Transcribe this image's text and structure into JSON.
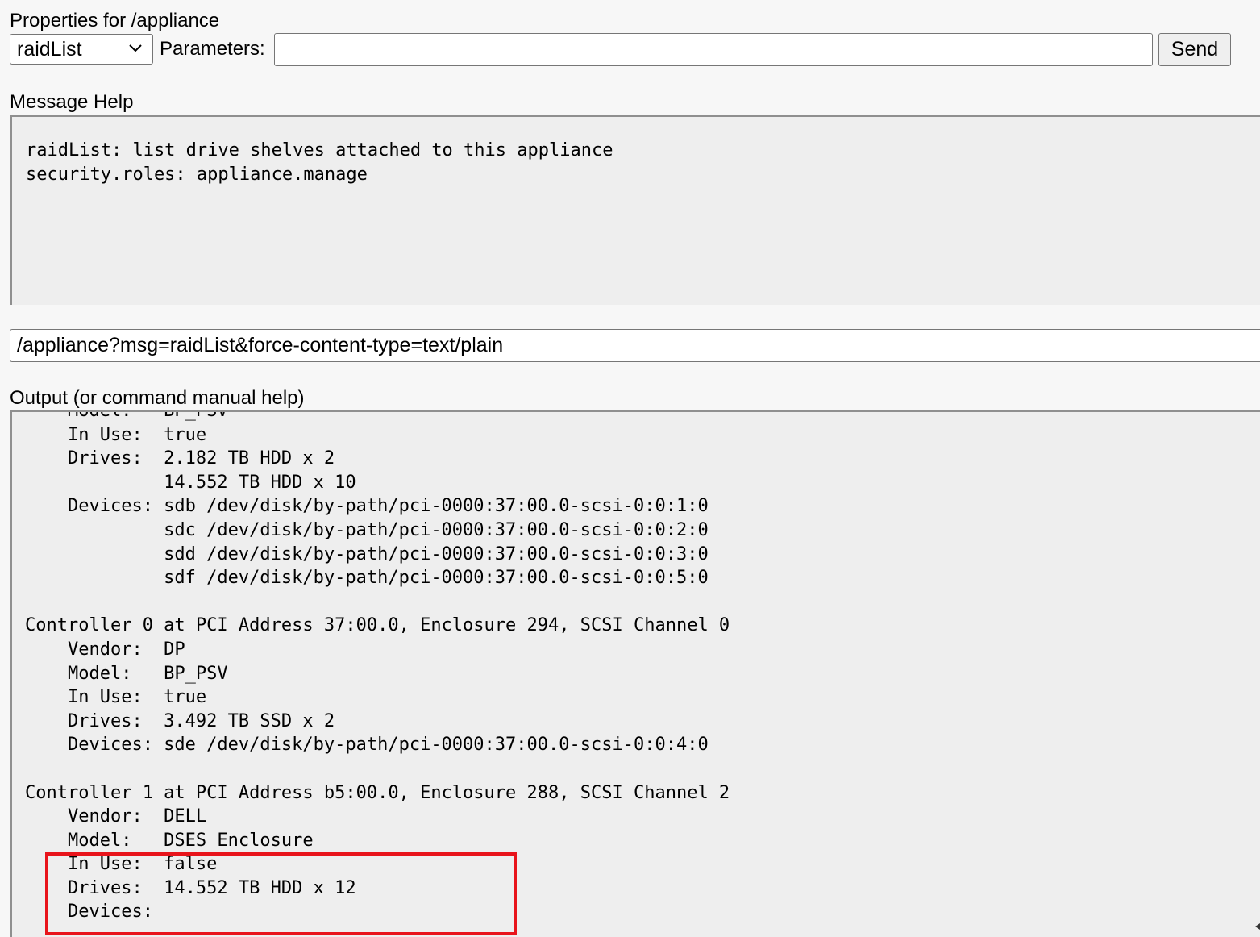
{
  "header": {
    "title": "Properties for /appliance",
    "message_select": {
      "value": "raidList",
      "icon": "chevron-down-icon"
    },
    "parameters_label": "Parameters:",
    "parameters_value": "",
    "send_label": "Send"
  },
  "help": {
    "label": "Message Help",
    "text": "raidList: list drive shelves attached to this appliance\nsecurity.roles: appliance.manage"
  },
  "request": {
    "url": "/appliance?msg=raidList&force-content-type=text/plain"
  },
  "output": {
    "label": "Output (or command manual help)",
    "text": "    Model:   BP_PSV\n    In Use:  true\n    Drives:  2.182 TB HDD x 2\n             14.552 TB HDD x 10\n    Devices: sdb /dev/disk/by-path/pci-0000:37:00.0-scsi-0:0:1:0\n             sdc /dev/disk/by-path/pci-0000:37:00.0-scsi-0:0:2:0\n             sdd /dev/disk/by-path/pci-0000:37:00.0-scsi-0:0:3:0\n             sdf /dev/disk/by-path/pci-0000:37:00.0-scsi-0:0:5:0\n\nController 0 at PCI Address 37:00.0, Enclosure 294, SCSI Channel 0\n    Vendor:  DP\n    Model:   BP_PSV\n    In Use:  true\n    Drives:  3.492 TB SSD x 2\n    Devices: sde /dev/disk/by-path/pci-0000:37:00.0-scsi-0:0:4:0\n\nController 1 at PCI Address b5:00.0, Enclosure 288, SCSI Channel 2\n    Vendor:  DELL\n    Model:   DSES Enclosure\n    In Use:  false\n    Drives:  14.552 TB HDD x 12\n    Devices:"
  },
  "colors": {
    "highlight": "#e8141b",
    "panel_background": "#eeeeee",
    "page_background": "#f7f7f7"
  }
}
